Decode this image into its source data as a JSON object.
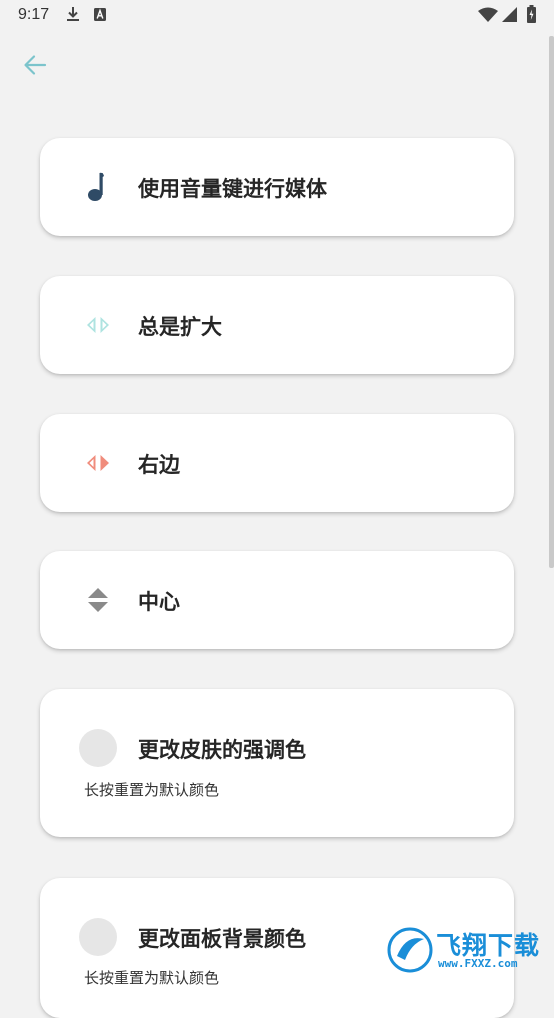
{
  "status_bar": {
    "time": "9:17"
  },
  "cards": [
    {
      "label": "使用音量键进行媒体",
      "icon": "music-note-icon",
      "icon_color": "#2f4b66"
    },
    {
      "label": "总是扩大",
      "icon": "expand-arrows-icon",
      "icon_color": "#aee3e0"
    },
    {
      "label": "右边",
      "icon": "right-side-arrows-icon",
      "icon_color": "#f08c7c"
    },
    {
      "label": "中心",
      "icon": "center-arrows-icon",
      "icon_color": "#8a8a8a"
    },
    {
      "label": "更改皮肤的强调色",
      "sublabel": "长按重置为默认颜色"
    },
    {
      "label": "更改面板背景颜色",
      "sublabel": "长按重置为默认颜色"
    }
  ],
  "watermark": {
    "title": "飞翔下载",
    "url": "www.FXXZ.com"
  },
  "colors": {
    "back_arrow": "#7cc4cc",
    "background": "#f2f2f2",
    "card": "#ffffff"
  }
}
